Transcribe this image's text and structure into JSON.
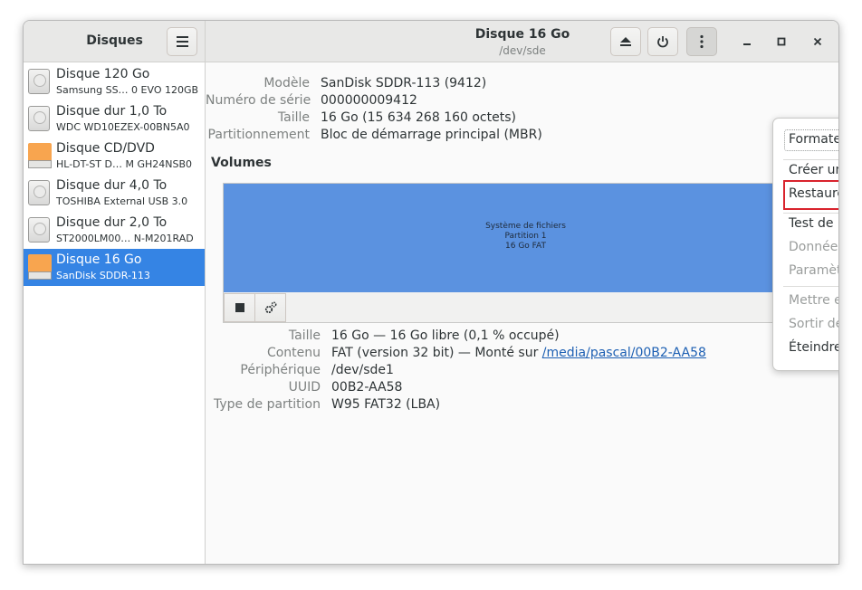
{
  "sidebar": {
    "title": "Disques",
    "disks": [
      {
        "name": "Disque 120 Go",
        "model": "Samsung SS…   0 EVO 120GB",
        "icon": "hdd-icon"
      },
      {
        "name": "Disque dur 1,0 To",
        "model": "WDC WD10EZEX-00BN5A0",
        "icon": "hdd-icon"
      },
      {
        "name": "Disque CD/DVD",
        "model": "HL-DT-ST D…   M GH24NSB0",
        "icon": "optical-drive-icon"
      },
      {
        "name": "Disque dur 4,0 To",
        "model": "TOSHIBA External USB 3.0",
        "icon": "hdd-icon"
      },
      {
        "name": "Disque dur 2,0 To",
        "model": "ST2000LM00…   N-M201RAD",
        "icon": "hdd-icon"
      },
      {
        "name": "Disque 16 Go",
        "model": "SanDisk SDDR-113",
        "icon": "removable-drive-icon",
        "selected": true
      }
    ]
  },
  "header": {
    "title": "Disque 16 Go",
    "subtitle": "/dev/sde"
  },
  "disk_info": {
    "model_label": "Modèle",
    "model_value": "SanDisk SDDR-113 (9412)",
    "serial_label": "Numéro de série",
    "serial_value": "000000009412",
    "size_label": "Taille",
    "size_value": "16 Go (15 634 268 160 octets)",
    "partitioning_label": "Partitionnement",
    "partitioning_value": "Bloc de démarrage principal (MBR)"
  },
  "volumes": {
    "title": "Volumes",
    "partition_line1": "Système de fichiers",
    "partition_line2": "Partition 1",
    "partition_line3": "16 Go FAT"
  },
  "volume_info": {
    "size_label": "Taille",
    "size_value": "16 Go — 16 Go libre (0,1 % occupé)",
    "contents_label": "Contenu",
    "contents_prefix": "FAT (version 32 bit) — Monté sur ",
    "contents_link": "/media/pascal/00B2-AA58",
    "device_label": "Périphérique",
    "device_value": "/dev/sde1",
    "uuid_label": "UUID",
    "uuid_value": "00B2-AA58",
    "parttype_label": "Type de partition",
    "parttype_value": "W95 FAT32 (LBA)"
  },
  "menu": {
    "format": "Formater le disque…",
    "create_image": "Créer une image disque…",
    "restore_image": "Restaurer l’image disque…",
    "benchmark": "Test de performance du disque…",
    "smart": "Données SMART et auto-tests…",
    "settings": "Paramètres du disque…",
    "standby": "Mettre en veille maintenant",
    "wakeup": "Sortir de veille",
    "poweroff": "Éteindre"
  },
  "colors": {
    "selection": "#3584e4",
    "partition": "#5b92e0",
    "highlight": "#d9232d"
  }
}
